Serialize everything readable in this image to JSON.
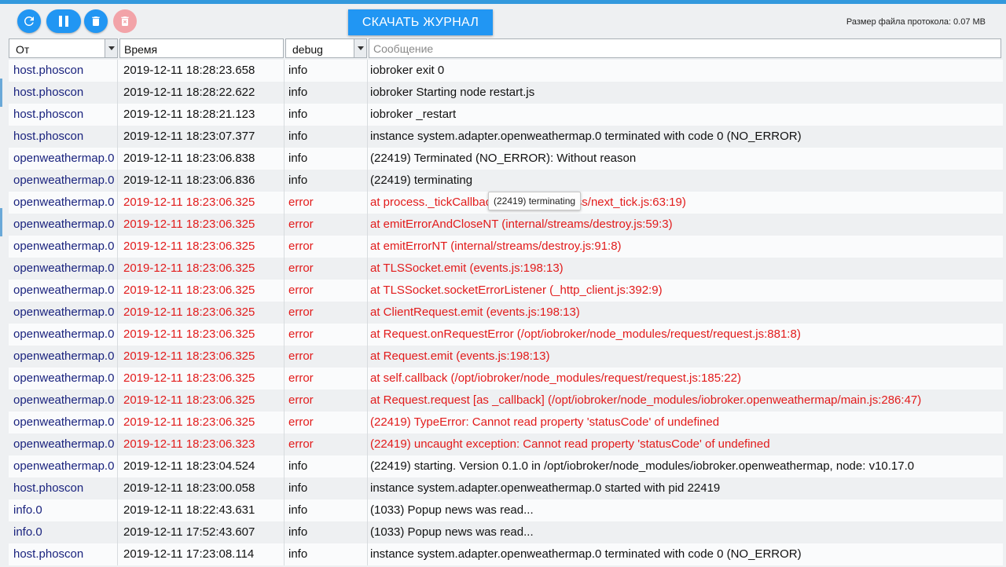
{
  "toolbar": {
    "download_label": "СКАЧАТЬ ЖУРНАЛ",
    "file_size_label": "Размер файла протокола:",
    "file_size_value": "0.07 MB",
    "buttons": [
      "refresh-icon",
      "pause-icon",
      "trash-icon",
      "delete-file-icon"
    ]
  },
  "filters": {
    "from": "От",
    "time": "Время",
    "severity": "debug",
    "message_placeholder": "Сообщение"
  },
  "colors": {
    "accent": "#2196f3",
    "error": "#e21b1b",
    "source": "#1a237e",
    "disabled": "#f2a3a8"
  },
  "log": [
    {
      "from": "host.phoscon",
      "time": "2019-12-11 18:28:23.658",
      "severity": "info",
      "message": "iobroker exit 0"
    },
    {
      "from": "host.phoscon",
      "time": "2019-12-11 18:28:22.622",
      "severity": "info",
      "message": "iobroker Starting node restart.js"
    },
    {
      "from": "host.phoscon",
      "time": "2019-12-11 18:28:21.123",
      "severity": "info",
      "message": "iobroker _restart"
    },
    {
      "from": "host.phoscon",
      "time": "2019-12-11 18:23:07.377",
      "severity": "info",
      "message": "instance system.adapter.openweathermap.0 terminated with code 0 (NO_ERROR)"
    },
    {
      "from": "openweathermap.0",
      "time": "2019-12-11 18:23:06.838",
      "severity": "info",
      "message": "(22419) Terminated (NO_ERROR): Without reason"
    },
    {
      "from": "openweathermap.0",
      "time": "2019-12-11 18:23:06.836",
      "severity": "info",
      "message": "(22419) terminating"
    },
    {
      "from": "openweathermap.0",
      "time": "2019-12-11 18:23:06.325",
      "severity": "error",
      "message": "at process._tickCallback (internal/process/next_tick.js:63:19)"
    },
    {
      "from": "openweathermap.0",
      "time": "2019-12-11 18:23:06.325",
      "severity": "error",
      "message": "at emitErrorAndCloseNT (internal/streams/destroy.js:59:3)"
    },
    {
      "from": "openweathermap.0",
      "time": "2019-12-11 18:23:06.325",
      "severity": "error",
      "message": "at emitErrorNT (internal/streams/destroy.js:91:8)"
    },
    {
      "from": "openweathermap.0",
      "time": "2019-12-11 18:23:06.325",
      "severity": "error",
      "message": "at TLSSocket.emit (events.js:198:13)"
    },
    {
      "from": "openweathermap.0",
      "time": "2019-12-11 18:23:06.325",
      "severity": "error",
      "message": "at TLSSocket.socketErrorListener (_http_client.js:392:9)"
    },
    {
      "from": "openweathermap.0",
      "time": "2019-12-11 18:23:06.325",
      "severity": "error",
      "message": "at ClientRequest.emit (events.js:198:13)"
    },
    {
      "from": "openweathermap.0",
      "time": "2019-12-11 18:23:06.325",
      "severity": "error",
      "message": "at Request.onRequestError (/opt/iobroker/node_modules/request/request.js:881:8)"
    },
    {
      "from": "openweathermap.0",
      "time": "2019-12-11 18:23:06.325",
      "severity": "error",
      "message": "at Request.emit (events.js:198:13)"
    },
    {
      "from": "openweathermap.0",
      "time": "2019-12-11 18:23:06.325",
      "severity": "error",
      "message": "at self.callback (/opt/iobroker/node_modules/request/request.js:185:22)"
    },
    {
      "from": "openweathermap.0",
      "time": "2019-12-11 18:23:06.325",
      "severity": "error",
      "message": "at Request.request [as _callback] (/opt/iobroker/node_modules/iobroker.openweathermap/main.js:286:47)"
    },
    {
      "from": "openweathermap.0",
      "time": "2019-12-11 18:23:06.325",
      "severity": "error",
      "message": "(22419) TypeError: Cannot read property 'statusCode' of undefined"
    },
    {
      "from": "openweathermap.0",
      "time": "2019-12-11 18:23:06.323",
      "severity": "error",
      "message": "(22419) uncaught exception: Cannot read property 'statusCode' of undefined"
    },
    {
      "from": "openweathermap.0",
      "time": "2019-12-11 18:23:04.524",
      "severity": "info",
      "message": "(22419) starting. Version 0.1.0 in /opt/iobroker/node_modules/iobroker.openweathermap, node: v10.17.0"
    },
    {
      "from": "host.phoscon",
      "time": "2019-12-11 18:23:00.058",
      "severity": "info",
      "message": "instance system.adapter.openweathermap.0 started with pid 22419"
    },
    {
      "from": "info.0",
      "time": "2019-12-11 18:22:43.631",
      "severity": "info",
      "message": "(1033) Popup news was read..."
    },
    {
      "from": "info.0",
      "time": "2019-12-11 17:52:43.607",
      "severity": "info",
      "message": "(1033) Popup news was read..."
    },
    {
      "from": "host.phoscon",
      "time": "2019-12-11 17:23:08.114",
      "severity": "info",
      "message": "instance system.adapter.openweathermap.0 terminated with code 0 (NO_ERROR)"
    }
  ],
  "tooltip": "(22419) terminating"
}
